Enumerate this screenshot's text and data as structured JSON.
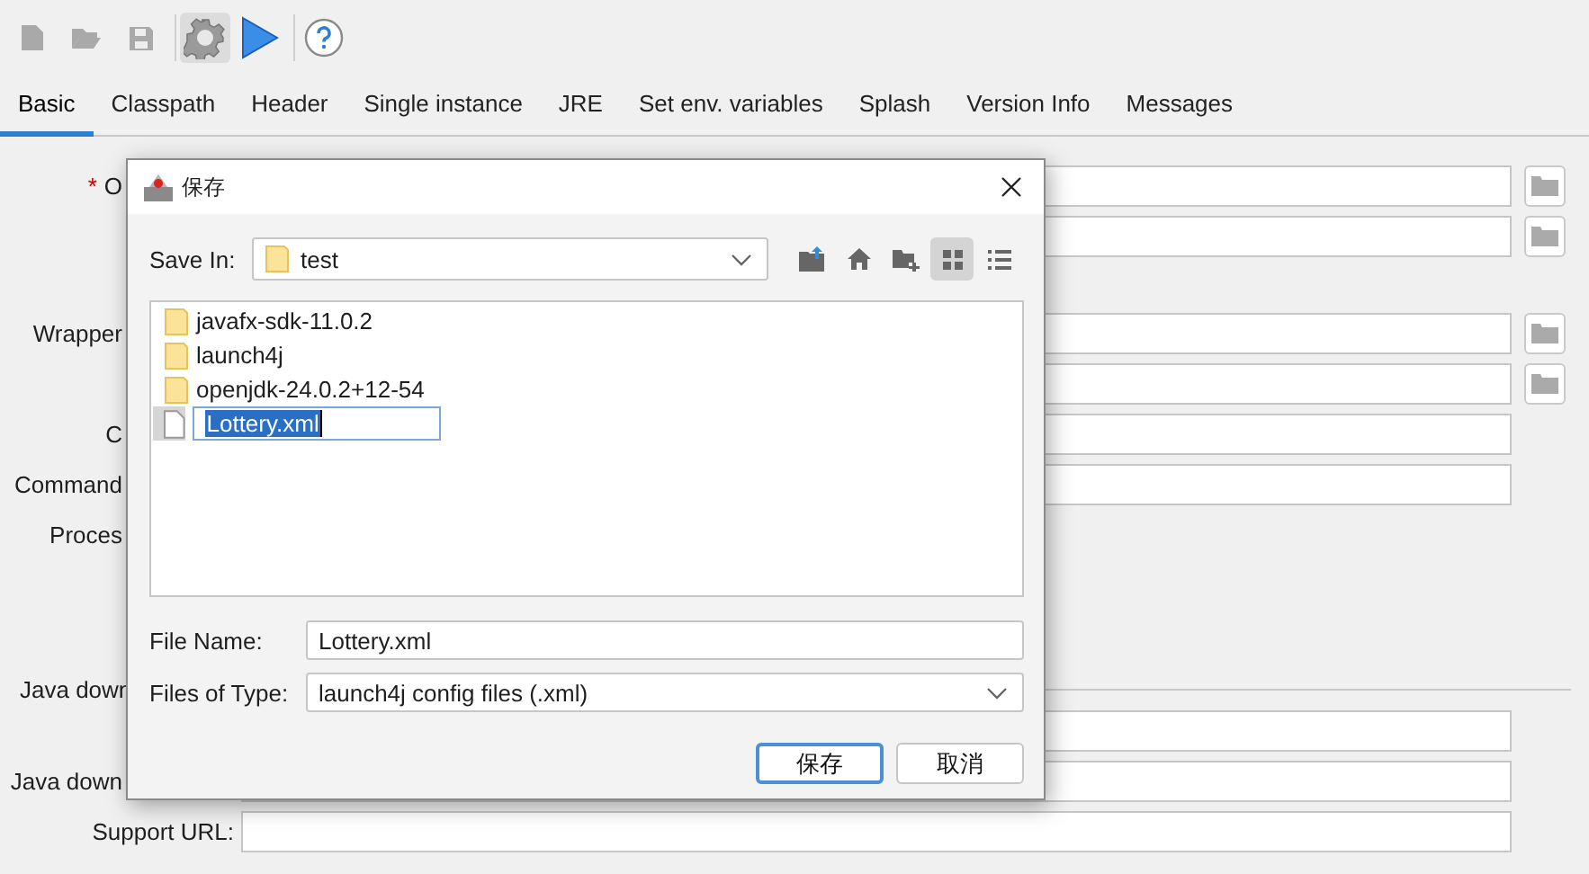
{
  "toolbar": [
    {
      "kind": "new",
      "disabled": true,
      "selected": false
    },
    {
      "kind": "open",
      "disabled": true,
      "selected": false
    },
    {
      "kind": "save",
      "disabled": true,
      "selected": false
    },
    {
      "kind": "settings",
      "disabled": false,
      "selected": true
    },
    {
      "kind": "run",
      "disabled": false,
      "selected": false
    },
    {
      "kind": "help",
      "disabled": false,
      "selected": false
    }
  ],
  "tabs": [
    {
      "label": "Basic",
      "selected": true
    },
    {
      "label": "Classpath",
      "selected": false
    },
    {
      "label": "Header",
      "selected": false
    },
    {
      "label": "Single instance",
      "selected": false
    },
    {
      "label": "JRE",
      "selected": false
    },
    {
      "label": "Set env. variables",
      "selected": false
    },
    {
      "label": "Splash",
      "selected": false
    },
    {
      "label": "Version Info",
      "selected": false
    },
    {
      "label": "Messages",
      "selected": false
    }
  ],
  "form": {
    "sections": [
      {
        "rows": [
          {
            "label": "O",
            "required_mark": "*",
            "browse": true
          },
          {
            "browse": true
          }
        ]
      },
      {
        "rows": [
          {
            "label": "Wrapper",
            "browse": true
          },
          {
            "browse": true
          },
          {
            "label": "C",
            "field": true
          },
          {
            "label": "Command",
            "field": true
          },
          {
            "label": "Proces"
          }
        ]
      }
    ],
    "java_download": {
      "heading": "Java down",
      "rows": [
        {
          "field": true
        },
        {
          "label": "Java down",
          "field": true
        }
      ]
    },
    "support_url": {
      "label": "Support URL:"
    }
  },
  "dialog": {
    "title": "保存",
    "save_in": {
      "label": "Save In:",
      "value": "test"
    },
    "view_buttons": [
      {
        "kind": "up",
        "selected": false
      },
      {
        "kind": "home",
        "selected": false
      },
      {
        "kind": "new-folder",
        "selected": false
      },
      {
        "kind": "grid",
        "selected": true
      },
      {
        "kind": "details",
        "selected": false
      }
    ],
    "files": [
      {
        "kind": "folder",
        "name": "javafx-sdk-11.0.2",
        "selected": false
      },
      {
        "kind": "folder",
        "name": "launch4j",
        "selected": false
      },
      {
        "kind": "folder",
        "name": "openjdk-24.0.2+12-54",
        "selected": false
      },
      {
        "kind": "file",
        "name": "Lottery.xml",
        "selected": true
      }
    ],
    "file_name": {
      "label": "File Name:",
      "value": "Lottery.xml"
    },
    "file_type": {
      "label": "Files of Type:",
      "value": "launch4j config files (.xml)"
    },
    "buttons": [
      {
        "label": "保存",
        "default": true
      },
      {
        "label": "取消",
        "default": false
      }
    ]
  }
}
